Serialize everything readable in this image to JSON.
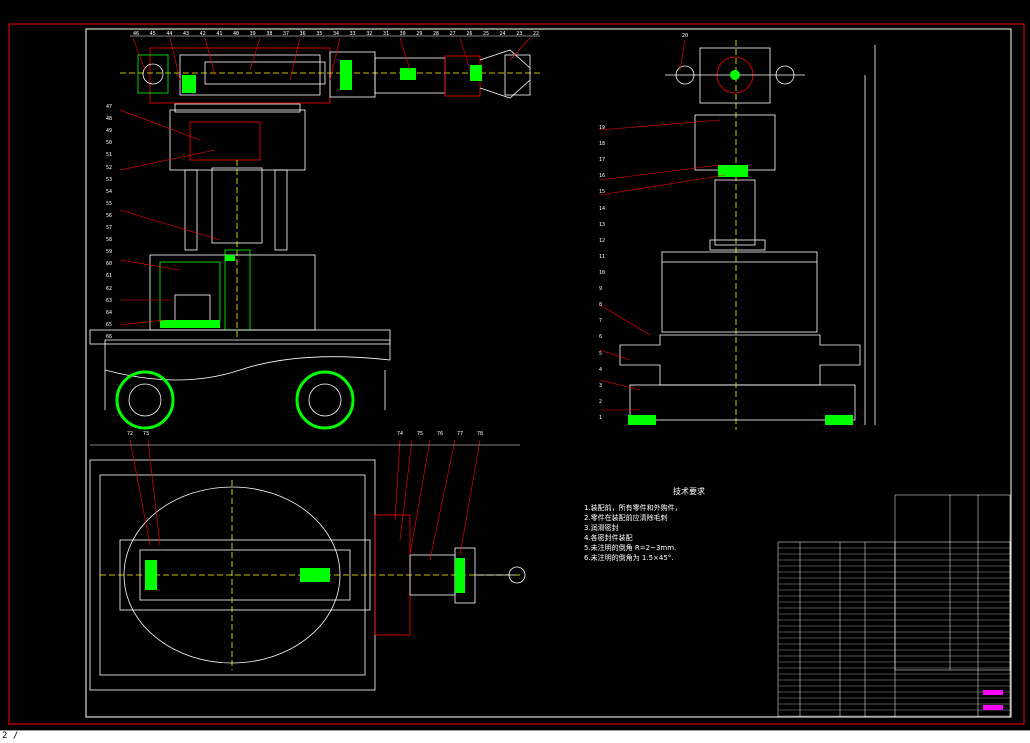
{
  "colors": {
    "background": "#000000",
    "line": "#ffffff",
    "green": "#00ff00",
    "red": "#ff0000",
    "magenta": "#ff00ff",
    "yellow": "#ffff00",
    "cyan": "#00ffff"
  },
  "tech_requirements": {
    "title": "技术要求",
    "lines": [
      "1.装配前，所有零件和外购件，",
      "2.零件在装配前应清除毛刺",
      "3.润滑密封",
      "4.各密封件装配",
      "5.未注明的倒角 R=2~3mm.",
      "6.未注明的倒角为 1.5×45°."
    ]
  },
  "balloons_top": [
    "46",
    "45",
    "44",
    "43",
    "42",
    "41",
    "40",
    "39",
    "38",
    "37",
    "36",
    "35",
    "34",
    "33",
    "32",
    "31",
    "30",
    "29",
    "28",
    "27",
    "26",
    "25",
    "24",
    "23",
    "22"
  ],
  "balloons_left": [
    "47",
    "48",
    "49",
    "50",
    "51",
    "52",
    "53",
    "54",
    "55",
    "56",
    "57",
    "58",
    "59",
    "60",
    "61",
    "62",
    "63",
    "64",
    "65",
    "66"
  ],
  "balloons_right": [
    "20",
    "19",
    "18",
    "17",
    "16",
    "15",
    "14",
    "13",
    "12",
    "11",
    "10",
    "9",
    "8",
    "7",
    "6",
    "5",
    "4",
    "3",
    "2",
    "1"
  ],
  "balloons_plan": [
    "72",
    "73",
    "74",
    "75",
    "76",
    "77",
    "78"
  ],
  "status_text": "2 /"
}
